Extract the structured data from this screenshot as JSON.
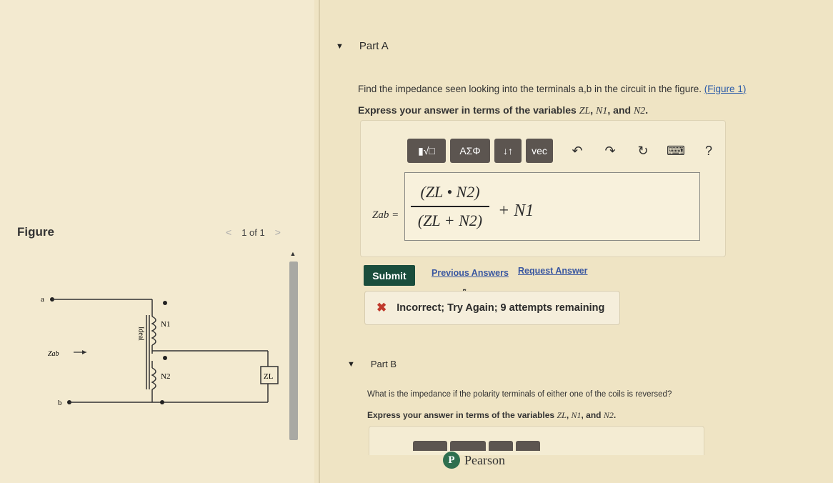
{
  "figure_panel": {
    "title": "Figure",
    "pager": {
      "prev": "<",
      "label": "1 of 1",
      "next": ">"
    },
    "circuit": {
      "terminal_a": "a",
      "terminal_b": "b",
      "zab_label": "Zab",
      "coil1_label": "N1",
      "coil2_label": "N2",
      "core_label": "Ideal",
      "load_label": "ZL"
    }
  },
  "part_a": {
    "header": "Part A",
    "question_prefix": "Find the impedance seen looking into the terminals a,b in the circuit in the figure.",
    "figure_link": "Figure 1",
    "instruction_prefix": "Express your answer in terms of the variables",
    "var_zl": "ZL",
    "var_n1": "N1",
    "var_n2": "N2",
    "instruction_and": "and",
    "toolbar": {
      "templates": "▮√□",
      "greek": "ΑΣΦ",
      "arrows": "↓↑",
      "vec": "vec",
      "undo_icon": "undo-icon",
      "redo_icon": "redo-icon",
      "reset_icon": "reset-icon",
      "keyboard_icon": "keyboard-icon",
      "help": "?"
    },
    "lhs": "Zab =",
    "answer": {
      "numerator": "(ZL • N2)",
      "denominator": "(ZL + N2)",
      "tail": "+ N1"
    },
    "submit_label": "Submit",
    "previous_answers": "Previous Answers",
    "request_answer": "Request Answer",
    "feedback": "Incorrect; Try Again; 9 attempts remaining"
  },
  "part_b": {
    "header": "Part B",
    "question": "What is the impedance if the polarity terminals of either one of the coils is reversed?",
    "instruction_prefix": "Express your answer in terms of the variables",
    "var_zl": "ZL",
    "var_n1": "N1",
    "var_n2": "N2",
    "instruction_and": "and"
  },
  "brand": {
    "logo_letter": "P",
    "name": "Pearson"
  },
  "colors": {
    "submit": "#1a4d3c",
    "incorrect": "#c0392b",
    "link": "#3a57a0",
    "toolbar": "#5c5550"
  }
}
